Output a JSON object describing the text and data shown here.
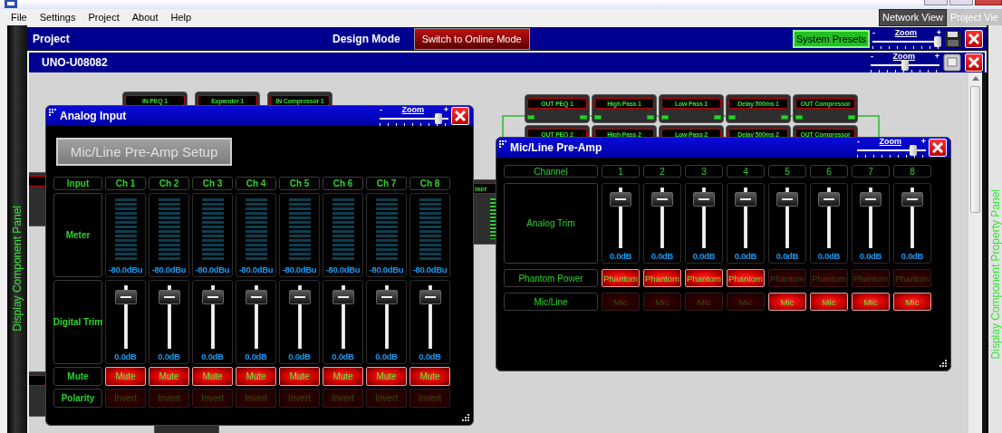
{
  "menu": [
    "File",
    "Settings",
    "Project",
    "About",
    "Help"
  ],
  "view_tabs": [
    {
      "label": "Network View",
      "selected": true
    },
    {
      "label": "Project Vie",
      "selected": false
    }
  ],
  "side_panels": {
    "left": "Display Component Panel",
    "right": "Display Component Property Panel"
  },
  "project_bar": {
    "title": "Project",
    "mode": "Design Mode",
    "mode_button": "Switch to Online Mode",
    "presets_button": "System Presets",
    "zoom": {
      "label": "Zoom",
      "min": "-",
      "max": "+",
      "level": 1
    }
  },
  "device_bar": {
    "title": "UNO-U08082",
    "zoom": {
      "label": "Zoom",
      "min": "-",
      "max": "+",
      "level": 0.5
    }
  },
  "canvas": {
    "nodes": [
      {
        "kind": "processor",
        "label": "IN PEQ 1"
      },
      {
        "kind": "processor",
        "label": "Expander 1"
      },
      {
        "kind": "processor",
        "label": "IN Compressor 1"
      },
      {
        "kind": "processor",
        "label": "OUT PEQ 1"
      },
      {
        "kind": "processor",
        "label": "High Pass 1"
      },
      {
        "kind": "processor",
        "label": "Low Pass 1"
      },
      {
        "kind": "processor",
        "label": "Delay 500ms 1"
      },
      {
        "kind": "processor",
        "label": "OUT Compressor"
      },
      {
        "kind": "processor",
        "label": "OUT PEQ 2"
      },
      {
        "kind": "processor",
        "label": "High Pass 2"
      },
      {
        "kind": "processor",
        "label": "Low Pass 2"
      },
      {
        "kind": "processor",
        "label": "Delay 500ms 2"
      },
      {
        "kind": "processor",
        "label": "OUT Compressor"
      },
      {
        "kind": "mixer",
        "label": "ixer"
      }
    ]
  },
  "analog_input": {
    "title": "Analog Input",
    "zoom": {
      "label": "Zoom",
      "min": "-",
      "max": "+",
      "level": 0.9
    },
    "setup_button": "Mic/Line Pre-Amp Setup",
    "row_labels": {
      "header": "Input",
      "meter": "Meter",
      "trim": "Digital Trim",
      "mute": "Mute",
      "polarity": "Polarity"
    },
    "channels": [
      {
        "name": "Ch 1",
        "meter": {
          "level": 0,
          "reading": "-80.0dBu"
        },
        "trim": {
          "level": 0.9,
          "reading": "0.0dB"
        },
        "mute": {
          "label": "Mute",
          "on": true
        },
        "invert": {
          "label": "Invert",
          "on": false
        }
      },
      {
        "name": "Ch 2",
        "meter": {
          "level": 0,
          "reading": "-80.0dBu"
        },
        "trim": {
          "level": 0.9,
          "reading": "0.0dB"
        },
        "mute": {
          "label": "Mute",
          "on": true
        },
        "invert": {
          "label": "Invert",
          "on": false
        }
      },
      {
        "name": "Ch 3",
        "meter": {
          "level": 0,
          "reading": "-80.0dBu"
        },
        "trim": {
          "level": 0.9,
          "reading": "0.0dB"
        },
        "mute": {
          "label": "Mute",
          "on": true
        },
        "invert": {
          "label": "Invert",
          "on": false
        }
      },
      {
        "name": "Ch 4",
        "meter": {
          "level": 0,
          "reading": "-80.0dBu"
        },
        "trim": {
          "level": 0.9,
          "reading": "0.0dB"
        },
        "mute": {
          "label": "Mute",
          "on": true
        },
        "invert": {
          "label": "Invert",
          "on": false
        }
      },
      {
        "name": "Ch 5",
        "meter": {
          "level": 0,
          "reading": "-80.0dBu"
        },
        "trim": {
          "level": 0.9,
          "reading": "0.0dB"
        },
        "mute": {
          "label": "Mute",
          "on": true
        },
        "invert": {
          "label": "Invert",
          "on": false
        }
      },
      {
        "name": "Ch 6",
        "meter": {
          "level": 0,
          "reading": "-80.0dBu"
        },
        "trim": {
          "level": 0.9,
          "reading": "0.0dB"
        },
        "mute": {
          "label": "Mute",
          "on": true
        },
        "invert": {
          "label": "Invert",
          "on": false
        }
      },
      {
        "name": "Ch 7",
        "meter": {
          "level": 0,
          "reading": "-80.0dBu"
        },
        "trim": {
          "level": 0.9,
          "reading": "0.0dB"
        },
        "mute": {
          "label": "Mute",
          "on": true
        },
        "invert": {
          "label": "Invert",
          "on": false
        }
      },
      {
        "name": "Ch 8",
        "meter": {
          "level": 0,
          "reading": "-80.0dBu"
        },
        "trim": {
          "level": 0.9,
          "reading": "0.0dB"
        },
        "mute": {
          "label": "Mute",
          "on": true
        },
        "invert": {
          "label": "Invert",
          "on": false
        }
      }
    ]
  },
  "preamp": {
    "title": "Mic/Line Pre-Amp",
    "zoom": {
      "label": "Zoom",
      "min": "-",
      "max": "+",
      "level": 0.85
    },
    "row_labels": {
      "header": "Channel",
      "trim": "Analog Trim",
      "phantom": "Phantom Power",
      "mic": "Mic/Line"
    },
    "channels": [
      {
        "name": "1",
        "trim": {
          "level": 0.9,
          "reading": "0.0dB"
        },
        "phantom": {
          "label": "Phantom",
          "on": true
        },
        "mic": {
          "label": "Mic",
          "on": false
        }
      },
      {
        "name": "2",
        "trim": {
          "level": 0.9,
          "reading": "0.0dB"
        },
        "phantom": {
          "label": "Phantom",
          "on": true
        },
        "mic": {
          "label": "Mic",
          "on": false
        }
      },
      {
        "name": "3",
        "trim": {
          "level": 0.9,
          "reading": "0.0dB"
        },
        "phantom": {
          "label": "Phantom",
          "on": true
        },
        "mic": {
          "label": "Mic",
          "on": false
        }
      },
      {
        "name": "4",
        "trim": {
          "level": 0.9,
          "reading": "0.0dB"
        },
        "phantom": {
          "label": "Phantom",
          "on": true
        },
        "mic": {
          "label": "Mic",
          "on": false
        }
      },
      {
        "name": "5",
        "trim": {
          "level": 0.9,
          "reading": "0.0dB"
        },
        "phantom": {
          "label": "Phantom",
          "on": false
        },
        "mic": {
          "label": "Mic",
          "on": true
        }
      },
      {
        "name": "6",
        "trim": {
          "level": 0.9,
          "reading": "0.0dB"
        },
        "phantom": {
          "label": "Phantom",
          "on": false
        },
        "mic": {
          "label": "Mic",
          "on": true
        }
      },
      {
        "name": "7",
        "trim": {
          "level": 0.9,
          "reading": "0.0dB"
        },
        "phantom": {
          "label": "Phantom",
          "on": false
        },
        "mic": {
          "label": "Mic",
          "on": true
        }
      },
      {
        "name": "8",
        "trim": {
          "level": 0.9,
          "reading": "0.0dB"
        },
        "phantom": {
          "label": "Phantom",
          "on": false
        },
        "mic": {
          "label": "Mic",
          "on": true
        }
      }
    ]
  }
}
